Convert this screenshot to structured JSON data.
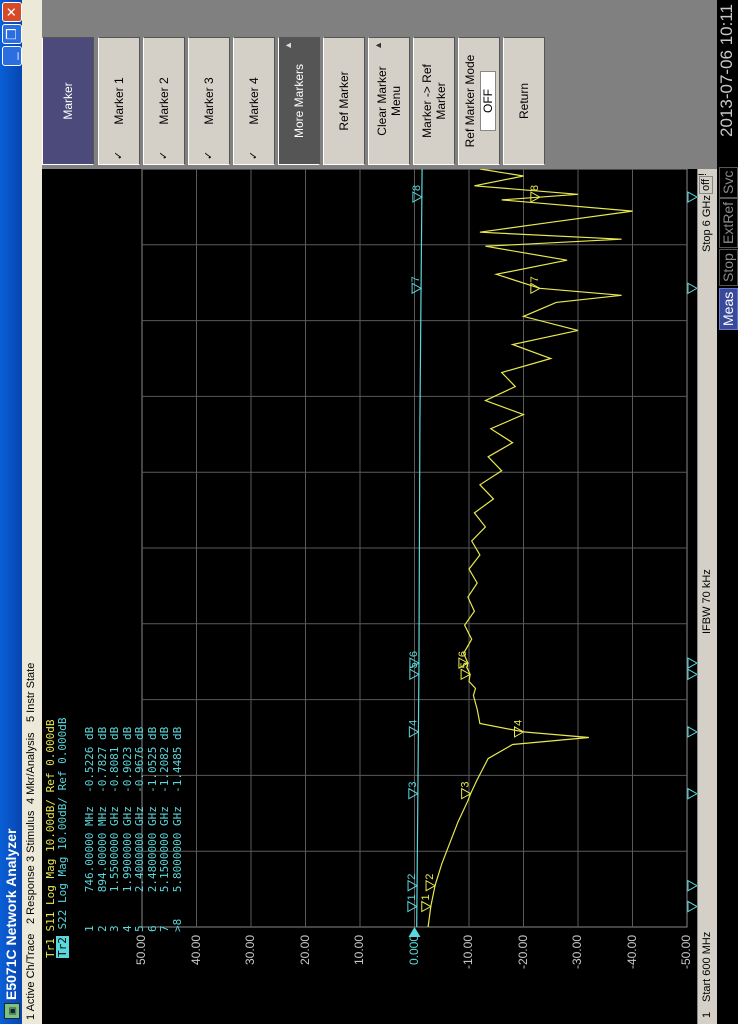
{
  "window": {
    "title": "E5071C Network Analyzer",
    "minimize_label": "_",
    "restore_label": "❐",
    "close_label": "✕"
  },
  "menu": [
    "1 Active Ch/Trace",
    "2 Response",
    "3 Stimulus",
    "4 Mkr/Analysis",
    "5 Instr State"
  ],
  "softkeys": {
    "header": "Marker",
    "items": [
      {
        "label": "Marker 1",
        "check": "✓"
      },
      {
        "label": "Marker 2",
        "check": "✓"
      },
      {
        "label": "Marker 3",
        "check": "✓"
      },
      {
        "label": "Marker 4",
        "check": "✓"
      },
      {
        "label": "More Markers",
        "arrow": "▲"
      },
      {
        "label": "Ref Marker"
      },
      {
        "label": "Clear Marker Menu",
        "arrow": "▲"
      },
      {
        "label": "Marker -> Ref Marker"
      },
      {
        "label": "Ref Marker Mode",
        "value": "OFF"
      },
      {
        "label": "Return"
      }
    ]
  },
  "traces": {
    "tr1": {
      "name": "Tr1",
      "param": "S11",
      "format": "Log Mag",
      "scale": "10.00dB/",
      "ref": "Ref 0.000dB",
      "color": "#e8e850"
    },
    "tr2": {
      "name": "Tr2",
      "param": "S22",
      "format": "Log Mag",
      "scale": "10.00dB/",
      "ref": "Ref 0.000dB",
      "color": "#5ad8dc"
    }
  },
  "markers": [
    {
      "num": "1",
      "freq": "746.00000",
      "unit": "MHz",
      "value": "-0.5226",
      "db": "dB"
    },
    {
      "num": "2",
      "freq": "894.00000",
      "unit": "MHz",
      "value": "-0.7827",
      "db": "dB"
    },
    {
      "num": "3",
      "freq": "1.5500000",
      "unit": "GHz",
      "value": "-0.8081",
      "db": "dB"
    },
    {
      "num": "4",
      "freq": "1.9900000",
      "unit": "GHz",
      "value": "-0.9023",
      "db": "dB"
    },
    {
      "num": "5",
      "freq": "2.4000000",
      "unit": "GHz",
      "value": "-0.9676",
      "db": "dB"
    },
    {
      "num": "6",
      "freq": "2.4800000",
      "unit": "GHz",
      "value": "-1.0525",
      "db": "dB"
    },
    {
      "num": "7",
      "freq": "5.1500000",
      "unit": "GHz",
      "value": "-1.2082",
      "db": "dB"
    },
    {
      ">8": ">8",
      "num": ">8",
      "freq": "5.8000000",
      "unit": "GHz",
      "value": "-1.4485",
      "db": "dB"
    }
  ],
  "y_scale_labels": [
    "50.00",
    "40.00",
    "30.00",
    "20.00",
    "10.00",
    "0.000",
    "-10.00",
    "-20.00",
    "-30.00",
    "-40.00",
    "-50.00"
  ],
  "status": {
    "channel": "1",
    "start": "Start 600 MHz",
    "ifbw": "IFBW 70 kHz",
    "stop": "Stop 6 GHz",
    "off_label": "off",
    "bang": "!"
  },
  "bottom_tags": [
    "Meas",
    "Stop",
    "ExtRef",
    "Svc"
  ],
  "clock": "2013-07-06 10:11",
  "colors": {
    "s11": "#e8e850",
    "s22": "#5ad8dc",
    "grid": "#5a5a5a",
    "softkey_active": "#4b4a7a"
  },
  "chart_data": {
    "type": "line",
    "xlabel": "",
    "ylabel": "",
    "x_range_hz": [
      600000000,
      6000000000
    ],
    "ylim": [
      -50,
      50
    ],
    "y_divisions": 10,
    "x_divisions": 10,
    "grid": true,
    "series": [
      {
        "name": "S11",
        "x_ghz": [
          0.6,
          0.75,
          0.9,
          1.05,
          1.2,
          1.35,
          1.5,
          1.55,
          1.65,
          1.8,
          1.9,
          1.95,
          1.99,
          2.05,
          2.15,
          2.25,
          2.3,
          2.35,
          2.4,
          2.45,
          2.48,
          2.55,
          2.65,
          2.75,
          2.85,
          2.95,
          3.05,
          3.15,
          3.25,
          3.35,
          3.45,
          3.55,
          3.65,
          3.75,
          3.85,
          3.95,
          4.05,
          4.15,
          4.25,
          4.35,
          4.45,
          4.55,
          4.65,
          4.75,
          4.85,
          4.95,
          5.05,
          5.1,
          5.15,
          5.25,
          5.35,
          5.45,
          5.5,
          5.55,
          5.62,
          5.7,
          5.78,
          5.82,
          5.88,
          5.95,
          6.0
        ],
        "y_db": [
          -2.5,
          -3.0,
          -3.8,
          -5.0,
          -6.5,
          -8.0,
          -9.8,
          -10.3,
          -11.5,
          -13.5,
          -18,
          -32,
          -20,
          -12,
          -11.5,
          -10.8,
          -11.2,
          -10.0,
          -10.2,
          -9.6,
          -9.8,
          -9.0,
          -10.5,
          -9.2,
          -11.0,
          -9.8,
          -11.5,
          -10.0,
          -12.0,
          -10.5,
          -13.0,
          -11.0,
          -14.5,
          -12.0,
          -16.0,
          -13.5,
          -18.0,
          -14.0,
          -20.0,
          -13.0,
          -18.5,
          -16.0,
          -25.0,
          -18.0,
          -30.0,
          -20.0,
          -26.0,
          -38.0,
          -23.0,
          -15.0,
          -28.0,
          -13.0,
          -38.0,
          -12.0,
          -25.0,
          -40.0,
          -16.0,
          -30.0,
          -11.0,
          -20.0,
          -12.0
        ]
      },
      {
        "name": "S22",
        "x_ghz": [
          0.6,
          1.5,
          2.4,
          3.3,
          4.2,
          5.1,
          6.0
        ],
        "y_db": [
          -0.4,
          -0.6,
          -0.8,
          -0.9,
          -1.0,
          -1.2,
          -1.4
        ]
      }
    ],
    "markers": [
      {
        "n": "1",
        "x_ghz": 0.746
      },
      {
        "n": "2",
        "x_ghz": 0.894
      },
      {
        "n": "3",
        "x_ghz": 1.55
      },
      {
        "n": "4",
        "x_ghz": 1.99
      },
      {
        "n": "5",
        "x_ghz": 2.4
      },
      {
        "n": "6",
        "x_ghz": 2.48
      },
      {
        "n": "7",
        "x_ghz": 5.15
      },
      {
        "n": "8",
        "x_ghz": 5.8
      }
    ]
  }
}
